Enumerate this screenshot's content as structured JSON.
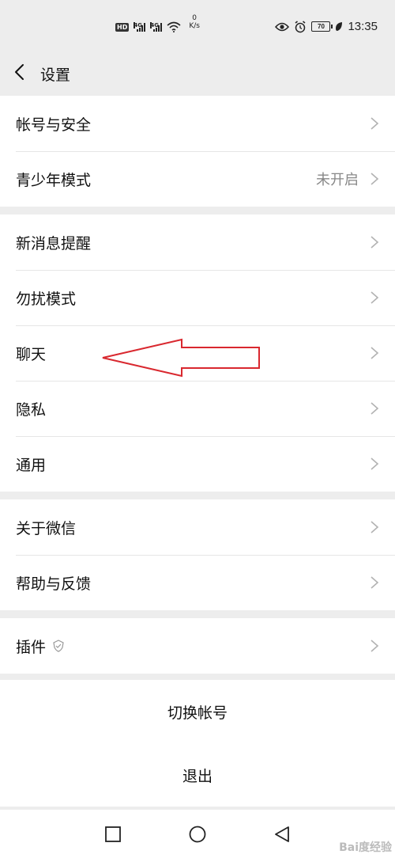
{
  "status_bar": {
    "hd_badge": "HD",
    "sim1_label": "4G",
    "sim2_label": "4G",
    "net_speed_value": "0",
    "net_speed_unit": "K/s",
    "battery_level": "70",
    "time": "13:35"
  },
  "header": {
    "title": "设置"
  },
  "groups": [
    {
      "items": [
        {
          "label": "帐号与安全",
          "value": ""
        },
        {
          "label": "青少年模式",
          "value": "未开启"
        }
      ]
    },
    {
      "items": [
        {
          "label": "新消息提醒",
          "value": ""
        },
        {
          "label": "勿扰模式",
          "value": ""
        },
        {
          "label": "聊天",
          "value": ""
        },
        {
          "label": "隐私",
          "value": ""
        },
        {
          "label": "通用",
          "value": ""
        }
      ]
    },
    {
      "items": [
        {
          "label": "关于微信",
          "value": ""
        },
        {
          "label": "帮助与反馈",
          "value": ""
        }
      ]
    },
    {
      "items": [
        {
          "label": "插件",
          "value": ""
        }
      ]
    }
  ],
  "actions": {
    "switch_account": "切换帐号",
    "logout": "退出"
  },
  "annotation": {
    "arrow_color": "#d9282f"
  },
  "watermark": "Bai度经验",
  "colors": {
    "background": "#ededed",
    "surface": "#ffffff",
    "text": "#111111",
    "secondary_text": "#888888",
    "chevron": "#b2b2b2"
  }
}
